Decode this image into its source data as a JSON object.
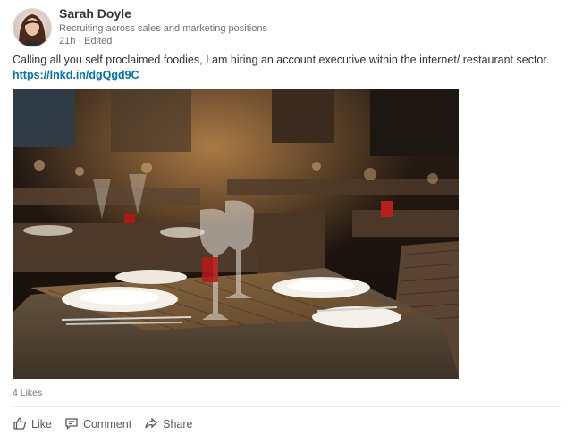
{
  "author": {
    "name": "Sarah Doyle",
    "headline": "Recruiting across sales and marketing positions",
    "meta": "21h · Edited"
  },
  "post": {
    "text": "Calling all you self proclaimed foodies, I am hiring an account executive within the internet/ restaurant sector.",
    "link": "https://lnkd.in/dgQgd9C"
  },
  "social": {
    "likes": "4 Likes"
  },
  "actions": {
    "like": "Like",
    "comment": "Comment",
    "share": "Share"
  },
  "icons": {
    "like": "thumbs-up-icon",
    "comment": "comment-icon",
    "share": "share-icon"
  },
  "colors": {
    "link": "#0073b1",
    "muted": "#737373"
  }
}
